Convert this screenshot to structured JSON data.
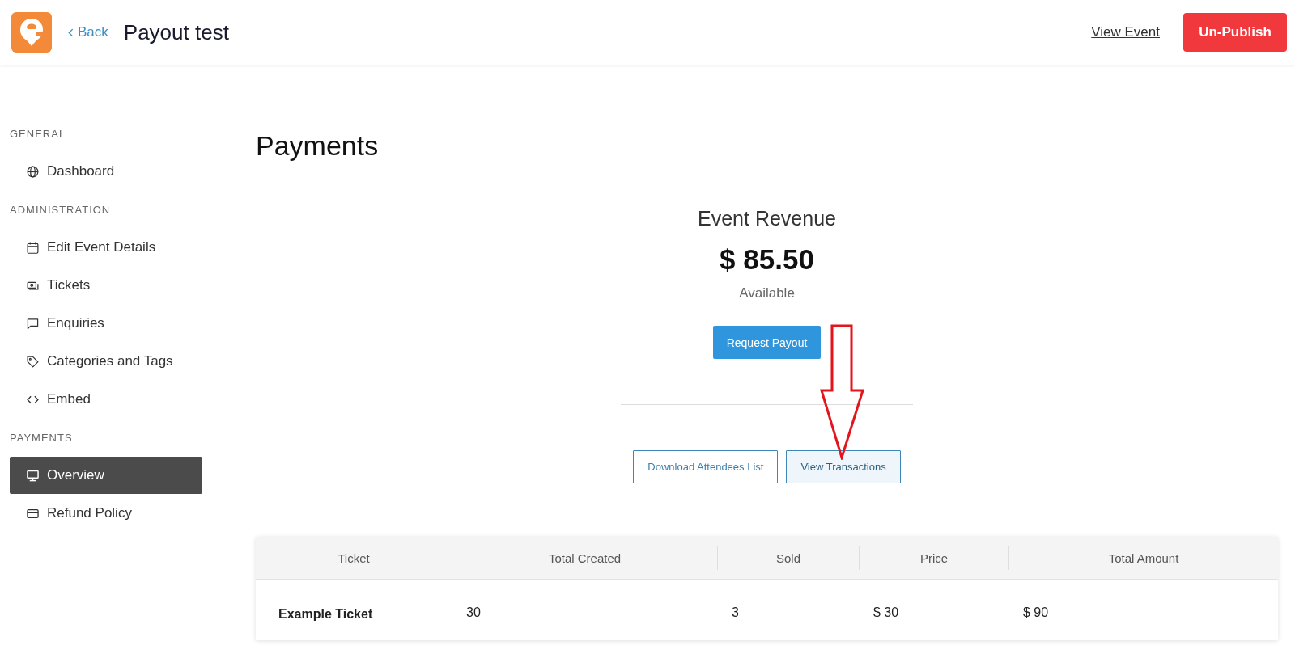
{
  "header": {
    "back_link": "Back",
    "title": "Payout test",
    "view_event_link": "View Event",
    "unpublish_button": "Un-Publish"
  },
  "sidebar": {
    "sections": [
      {
        "heading": "GENERAL",
        "items": [
          {
            "label": "Dashboard",
            "selected": false
          }
        ]
      },
      {
        "heading": "ADMINISTRATION",
        "items": [
          {
            "label": "Edit Event Details",
            "selected": false
          },
          {
            "label": "Tickets",
            "selected": false
          },
          {
            "label": "Enquiries",
            "selected": false
          },
          {
            "label": "Categories and Tags",
            "selected": false
          },
          {
            "label": "Embed",
            "selected": false
          }
        ]
      },
      {
        "heading": "PAYMENTS",
        "items": [
          {
            "label": "Overview",
            "selected": true
          },
          {
            "label": "Refund Policy",
            "selected": false
          }
        ]
      }
    ]
  },
  "main": {
    "heading": "Payments",
    "revenue": {
      "title": "Event Revenue",
      "amount": "$ 85.50",
      "caption": "Available",
      "button": "Request Payout"
    },
    "actions": [
      {
        "label": "Download Attendees List",
        "highlighted": false
      },
      {
        "label": "View Transactions",
        "highlighted": true
      }
    ],
    "table": {
      "columns": [
        "Ticket",
        "Total Created",
        "Sold",
        "Price",
        "Total Amount"
      ],
      "rows": [
        [
          "Example Ticket",
          "30",
          "3",
          "$ 30",
          "$ 90"
        ]
      ]
    }
  }
}
